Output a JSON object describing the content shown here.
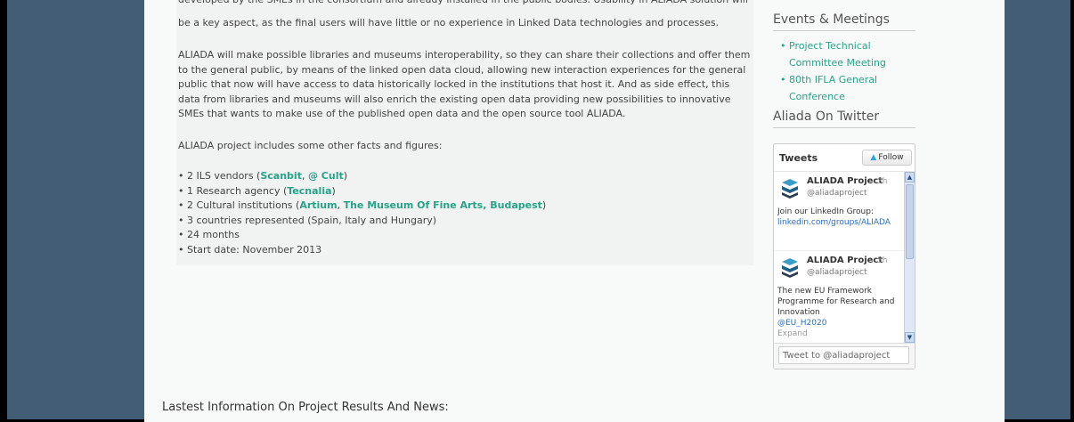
{
  "article": {
    "cut_line": "developed by the SMEs in the consortium and already installed in the public bodies. Usability in ALIADA solution will",
    "paragraph1": "be a key aspect, as the final users will have little or no experience in Linked Data technologies and processes.",
    "paragraph2": "ALIADA will make possible libraries and museums interoperability, so they can share  their collections and offer them to the general public, by means of the linked open data cloud, allowing new interaction experiences for the general public that now will have access to data historically locked in the institutions that host it. And as side effect, this data from libraries and museums will also enrich the existing open data providing new possibilities to innovative SMEs that wants to make use of the published open data and the open source tool ALIADA.",
    "paragraph3": "ALIADA project includes some other facts and figures:",
    "facts": {
      "f1_prefix": "2 ILS vendors (",
      "f1_link1": "Scanbit",
      "f1_sep": ", ",
      "f1_link2": "@ Cult",
      "f1_suffix": ")",
      "f2_prefix": "1 Research agency (",
      "f2_link1": "Tecnalia",
      "f2_suffix": ")",
      "f3_prefix": "2 Cultural institutions (",
      "f3_link1": "Artium",
      "f3_sep": ", ",
      "f3_link2": "The Museum Of Fine Arts, Budapest",
      "f3_suffix": ")",
      "f4": "3 countries represented (Spain, Italy and Hungary)",
      "f5": "24 months",
      "f6": "Start date: November 2013"
    }
  },
  "sidebar": {
    "events_title": "Events & Meetings",
    "events": [
      "Project Technical Committee Meeting",
      "80th IFLA General Conference"
    ],
    "twitter_title": "Aliada On Twitter"
  },
  "twitter": {
    "header": "Tweets",
    "follow_label": "Follow",
    "tweets": [
      {
        "author": "ALIADA Project",
        "time": "3h",
        "handle": "@aliadaproject",
        "text": "Join our LinkedIn Group:",
        "link": "linkedin.com/groups/ALIADA"
      },
      {
        "author": "ALIADA Project",
        "time": "5h",
        "handle": "@aliadaproject",
        "text": "The new EU Framework Programme for Research and Innovation",
        "link": "@EU_H2020",
        "expand": "Expand"
      }
    ],
    "input_placeholder": "Tweet to @aliadaproject"
  },
  "latest_heading": "Lastest Information On Project Results And News:",
  "colors": {
    "background": "#425d75",
    "link_green": "#27a387",
    "twitter_link": "#2a6ebb"
  }
}
